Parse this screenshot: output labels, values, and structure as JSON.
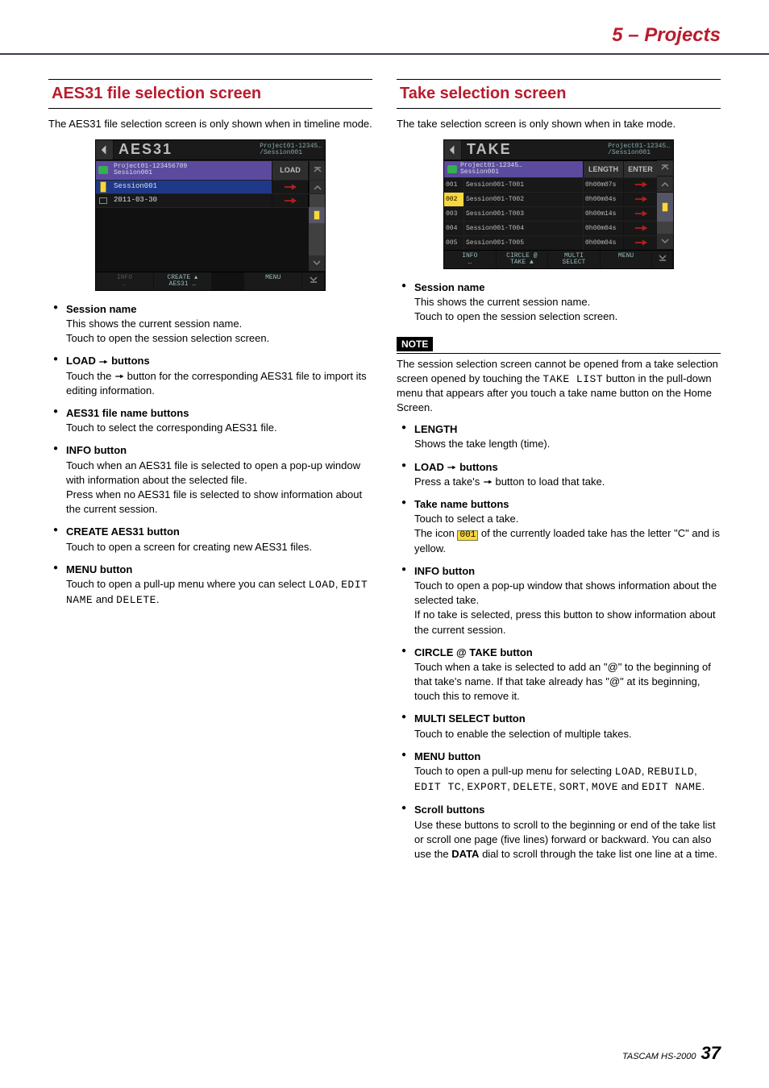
{
  "header": {
    "chapter": "5 – Projects"
  },
  "left": {
    "title": "AES31 file selection screen",
    "intro": "The AES31 file selection screen is only shown when in timeline mode.",
    "shot": {
      "screen_title": "AES31",
      "crumb1": "Project01-12345…",
      "crumb2": "/Session001",
      "row1_line1": "Project01-123456789",
      "row1_line2": "Session001",
      "row1_btn": "LOAD",
      "row2_name": "Session001",
      "row3_name": "2011-03-30",
      "footer_info": "INFO",
      "footer_create1": "CREATE",
      "footer_create2": "AES31",
      "footer_menu": "MENU"
    },
    "bullets": [
      {
        "head": "Session name",
        "body1": "This shows the current session name.",
        "body2": "Touch to open the session selection screen."
      },
      {
        "head_pre": "LOAD ",
        "head_post": " buttons",
        "body1_pre": "Touch the ",
        "body1_post": " button for the corresponding AES31 file to import its editing information."
      },
      {
        "head": "AES31 file name buttons",
        "body1": "Touch to select the corresponding AES31 file."
      },
      {
        "head": "INFO button",
        "body1": "Touch when an AES31 file is selected to open a pop-up window with information about the selected file.",
        "body2": "Press when no AES31 file is selected to show information about the current session."
      },
      {
        "head": "CREATE AES31 button",
        "body1": "Touch to open a screen for creating new AES31 files."
      },
      {
        "head": "MENU button",
        "body1_pre": "Touch to open a pull-up menu where you can select ",
        "lcd1": "LOAD",
        "sep1": ", ",
        "lcd2": "EDIT NAME",
        "sep2": " and ",
        "lcd3": "DELETE",
        "tail": "."
      }
    ]
  },
  "right": {
    "title": "Take selection screen",
    "intro": "The take selection screen is only shown when in take mode.",
    "shot": {
      "screen_title": "TAKE",
      "crumb1": "Project01-12345…",
      "crumb2": "/Session001",
      "sess_line1": "Project01-12345…",
      "sess_line2": "Session001",
      "col_length": "LENGTH",
      "col_enter": "ENTER",
      "rows": [
        {
          "num": "001",
          "name": "Session001-T001",
          "len": "0h00m07s",
          "current": false
        },
        {
          "num": "002",
          "name": "Session001-T002",
          "len": "0h00m04s",
          "current": true
        },
        {
          "num": "003",
          "name": "Session001-T003",
          "len": "0h00m14s",
          "current": false
        },
        {
          "num": "004",
          "name": "Session001-T004",
          "len": "0h00m04s",
          "current": false
        },
        {
          "num": "005",
          "name": "Session001-T005",
          "len": "0h00m04s",
          "current": false
        }
      ],
      "footer_info": "INFO",
      "footer_circle1": "CIRCLE @",
      "footer_circle2": "TAKE",
      "footer_multi1": "MULTI",
      "footer_multi2": "SELECT",
      "footer_menu": "MENU"
    },
    "note_label": "NOTE",
    "note_pre": "The session selection screen cannot be opened from a take selection screen opened by touching the ",
    "note_lcd": "TAKE LIST",
    "note_post": " button in the pull-down menu that appears after you touch a take name button on the Home Screen.",
    "bullets_top": [
      {
        "head": "Session name",
        "body1": "This shows the current session name.",
        "body2": "Touch to open the session selection screen."
      }
    ],
    "bullets": [
      {
        "head": "LENGTH",
        "body1": "Shows the take length (time)."
      },
      {
        "head_pre": "LOAD ",
        "head_post": " buttons",
        "body1_pre": "Press a take's ",
        "body1_post": " button to load that take."
      },
      {
        "head": "Take name buttons",
        "body1": "Touch to select a take.",
        "body2_pre": "The icon ",
        "icon_txt": "001",
        "body2_post": " of the currently loaded take has the letter \"C\" and is yellow."
      },
      {
        "head": "INFO button",
        "body1": "Touch to open a pop-up window that shows information about the selected take.",
        "body2": "If no take is selected, press this button to show information about the current session."
      },
      {
        "head": "CIRCLE @ TAKE button",
        "body1": "Touch when a take is selected to add an \"@\" to the beginning of that take's name. If that take already has \"@\" at its beginning, touch this to remove it."
      },
      {
        "head": "MULTI SELECT button",
        "body1": "Touch to enable the selection of multiple takes."
      },
      {
        "head": "MENU button",
        "body1_pre": "Touch to open a pull-up menu for selecting ",
        "lcds": [
          "LOAD",
          "REBUILD",
          "EDIT TC",
          "EXPORT",
          "DELETE",
          "SORT",
          "MOVE"
        ],
        "last_sep": " and ",
        "lcd_last": "EDIT NAME",
        "tail": "."
      },
      {
        "head": "Scroll buttons",
        "body1": "Use these buttons to scroll to the beginning or end of the take list or scroll one page (five lines) forward or backward. You can also use the ",
        "bold": "DATA",
        "body1_post": " dial to scroll through the take list one line at a time."
      }
    ]
  },
  "footer": {
    "model": "TASCAM HS-2000",
    "page": "37"
  }
}
